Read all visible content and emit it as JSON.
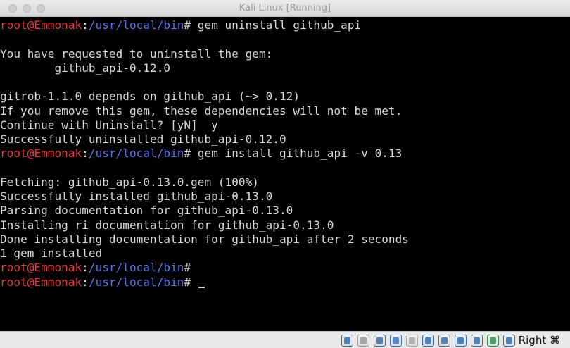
{
  "window": {
    "title": "Kali Linux [Running]"
  },
  "terminal": {
    "prompt_user": "root@Emmonak",
    "prompt_sep": ":",
    "prompt_path": "/usr/local/bin",
    "prompt_symbol": "# ",
    "lines": [
      {
        "type": "prompt",
        "command": "gem uninstall github_api"
      },
      {
        "type": "output",
        "text": ""
      },
      {
        "type": "output",
        "text": "You have requested to uninstall the gem:"
      },
      {
        "type": "output",
        "text": "        github_api-0.12.0"
      },
      {
        "type": "output",
        "text": ""
      },
      {
        "type": "output",
        "text": "gitrob-1.1.0 depends on github_api (~> 0.12)"
      },
      {
        "type": "output",
        "text": "If you remove this gem, these dependencies will not be met."
      },
      {
        "type": "output",
        "text": "Continue with Uninstall? [yN]  y"
      },
      {
        "type": "output",
        "text": "Successfully uninstalled github_api-0.12.0"
      },
      {
        "type": "prompt",
        "command": "gem install github_api -v 0.13"
      },
      {
        "type": "output",
        "text": ""
      },
      {
        "type": "output",
        "text": "Fetching: github_api-0.13.0.gem (100%)"
      },
      {
        "type": "output",
        "text": "Successfully installed github_api-0.13.0"
      },
      {
        "type": "output",
        "text": "Parsing documentation for github_api-0.13.0"
      },
      {
        "type": "output",
        "text": "Installing ri documentation for github_api-0.13.0"
      },
      {
        "type": "output",
        "text": "Done installing documentation for github_api after 2 seconds"
      },
      {
        "type": "output",
        "text": "1 gem installed"
      },
      {
        "type": "prompt",
        "command": ""
      },
      {
        "type": "prompt",
        "command": "",
        "cursor": true
      }
    ]
  },
  "statusbar": {
    "icons": [
      {
        "name": "hard-disk-icon",
        "color": "#2f6fb5"
      },
      {
        "name": "optical-drive-icon",
        "color": "#9a9a9a"
      },
      {
        "name": "audio-icon",
        "color": "#3a6ea5"
      },
      {
        "name": "network-icon",
        "color": "#3a74c4"
      },
      {
        "name": "usb-icon",
        "color": "#a8a8a8"
      },
      {
        "name": "shared-folders-icon",
        "color": "#2f6fb5"
      },
      {
        "name": "display-icon",
        "color": "#3a6ea5"
      },
      {
        "name": "video-capture-icon",
        "color": "#2f6fb5"
      },
      {
        "name": "cpu-icon",
        "color": "#2f6fb5"
      },
      {
        "name": "mouse-integration-icon",
        "color": "#2f8f4f"
      },
      {
        "name": "keyboard-capture-icon",
        "color": "#2f6fb5"
      }
    ],
    "host_key": "Right ⌘"
  }
}
